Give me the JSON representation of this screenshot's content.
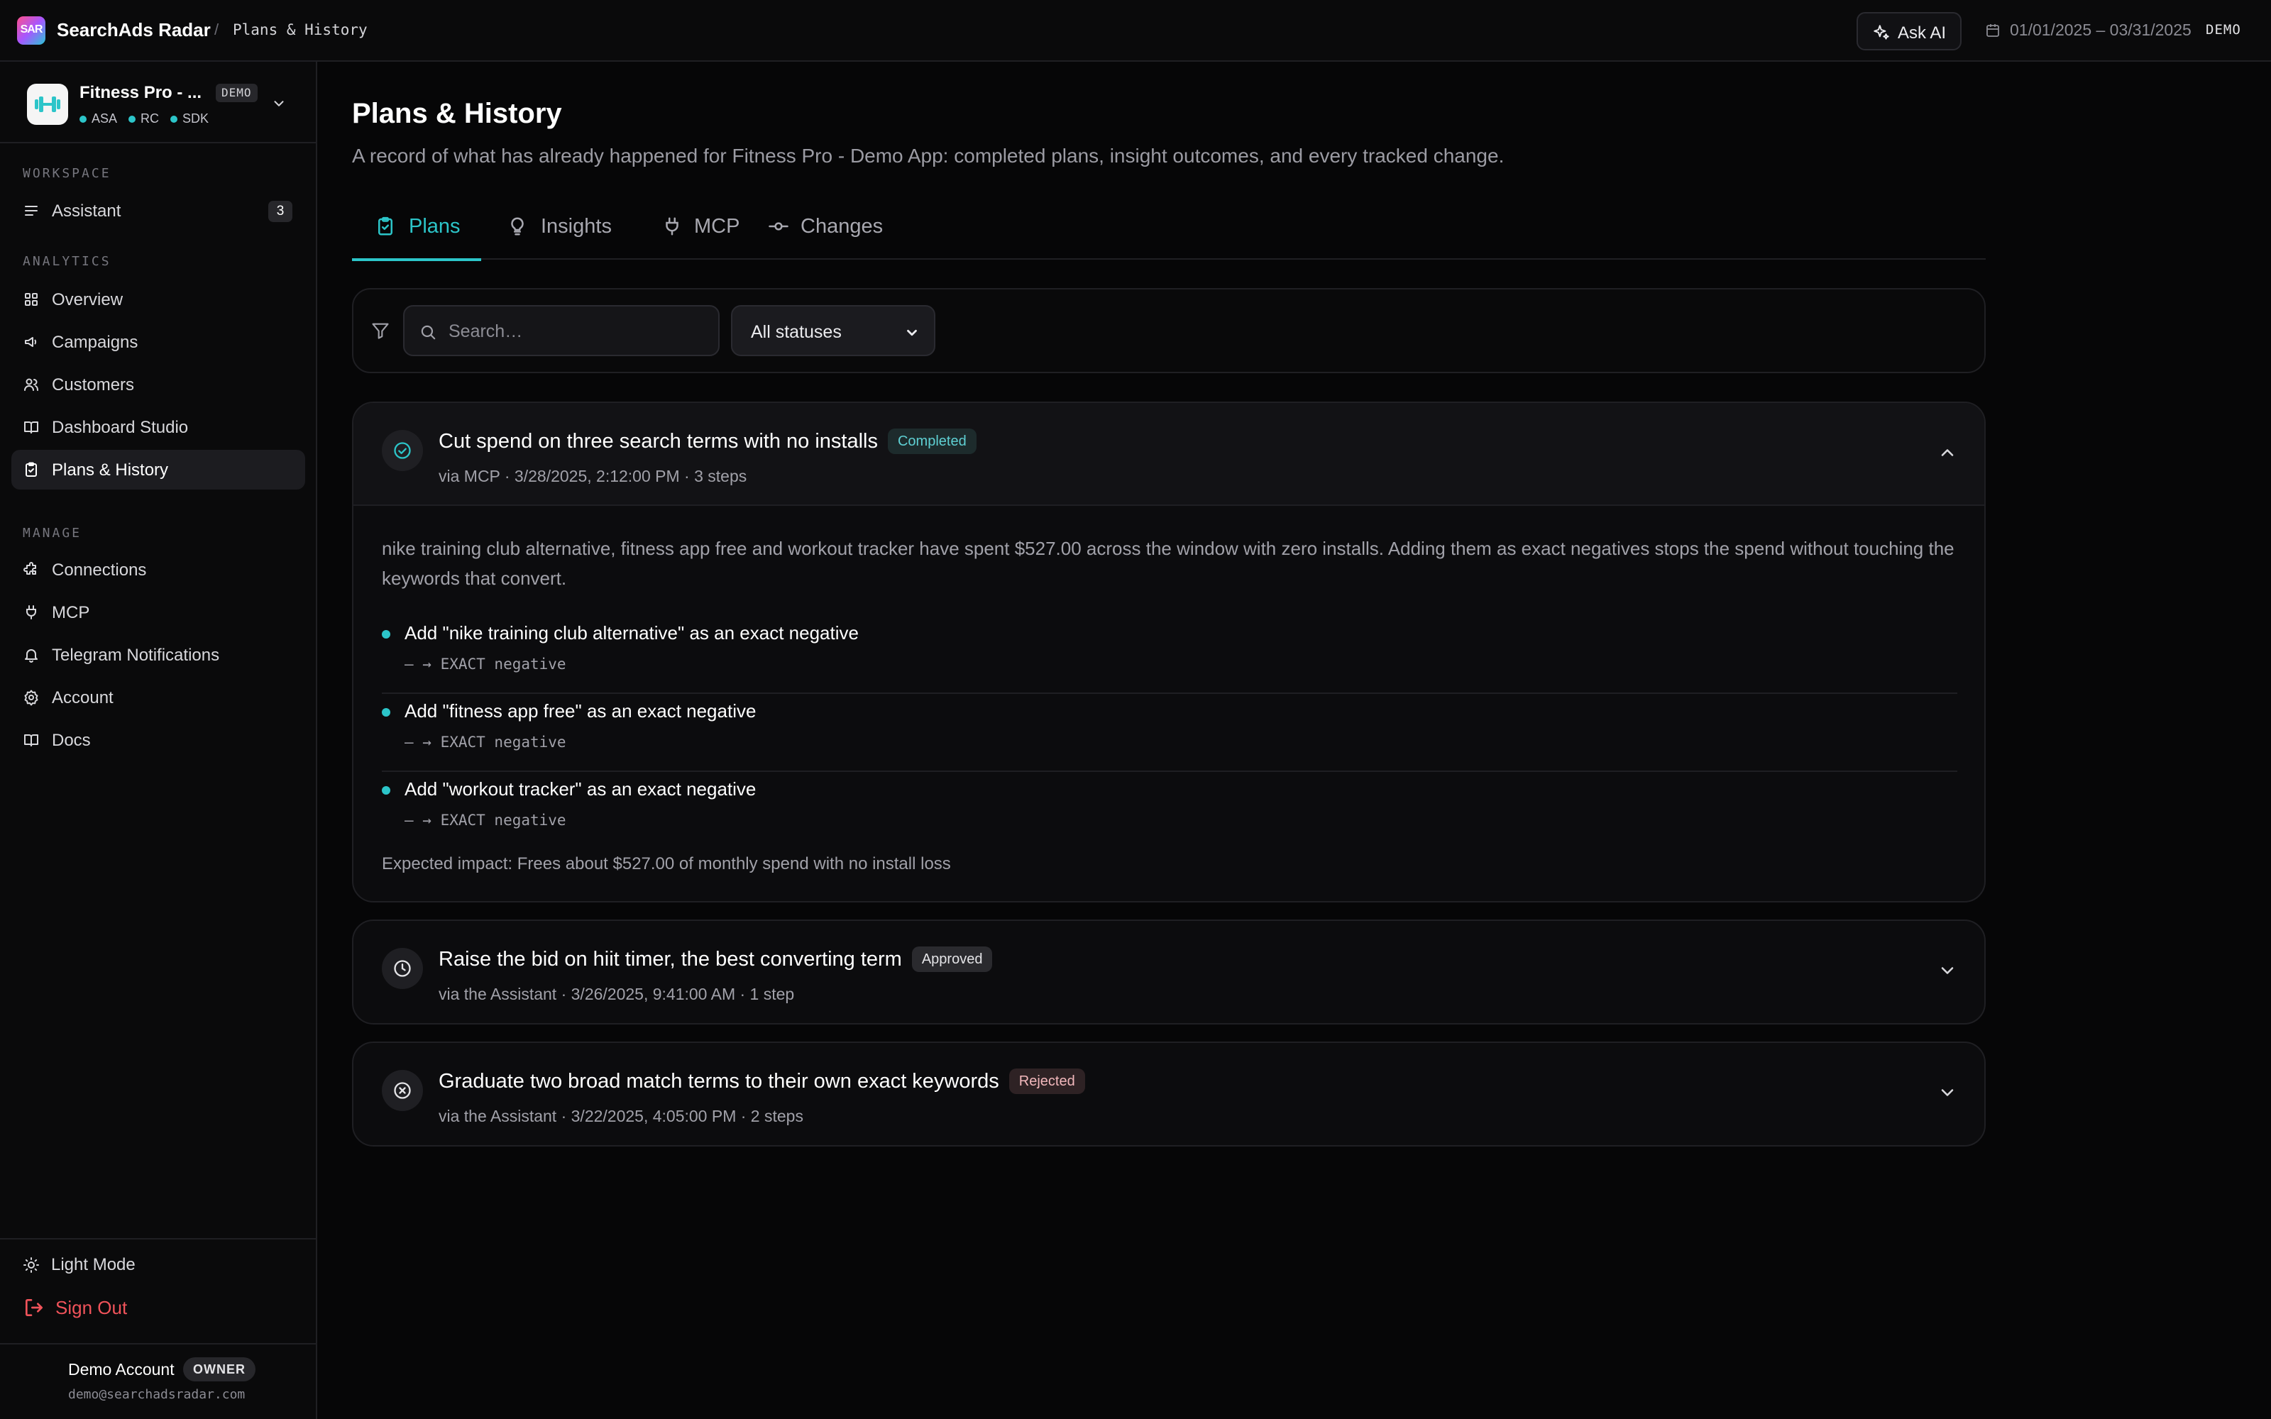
{
  "topbar": {
    "logo_text": "SAR",
    "brand": "SearchAds Radar",
    "separator": "/",
    "breadcrumb": "Plans & History",
    "ask_ai": "Ask AI",
    "date_range": "01/01/2025 – 03/31/2025",
    "demo": "DEMO"
  },
  "app": {
    "name": "Fitness Pro - ...",
    "badge": "DEMO",
    "sources": [
      "ASA",
      "RC",
      "SDK"
    ]
  },
  "sidebar": {
    "sections": [
      {
        "title": "WORKSPACE",
        "items": [
          {
            "label": "Assistant",
            "icon": "list-icon",
            "count": "3"
          }
        ]
      },
      {
        "title": "ANALYTICS",
        "items": [
          {
            "label": "Overview",
            "icon": "grid-icon"
          },
          {
            "label": "Campaigns",
            "icon": "megaphone-icon"
          },
          {
            "label": "Customers",
            "icon": "users-icon"
          },
          {
            "label": "Dashboard Studio",
            "icon": "book-open-icon"
          },
          {
            "label": "Plans & History",
            "icon": "clipboard-check-icon",
            "active": true
          }
        ]
      },
      {
        "title": "MANAGE",
        "items": [
          {
            "label": "Connections",
            "icon": "puzzle-icon"
          },
          {
            "label": "MCP",
            "icon": "plug-icon"
          },
          {
            "label": "Telegram Notifications",
            "icon": "bell-icon"
          },
          {
            "label": "Account",
            "icon": "gear-icon"
          },
          {
            "label": "Docs",
            "icon": "book-icon"
          }
        ]
      }
    ],
    "theme_toggle": "Light Mode",
    "sign_out": "Sign Out",
    "account": {
      "name": "Demo Account",
      "role": "OWNER",
      "email": "demo@searchadsradar.com"
    }
  },
  "page": {
    "title": "Plans & History",
    "subtitle": "A record of what has already happened for Fitness Pro - Demo App: completed plans, insight outcomes, and every tracked change."
  },
  "tabs": [
    {
      "label": "Plans",
      "icon": "clipboard-check-icon",
      "active": true
    },
    {
      "label": "Insights",
      "icon": "lightbulb-icon"
    },
    {
      "label": "MCP",
      "icon": "plug-icon"
    },
    {
      "label": "Changes",
      "icon": "commit-icon"
    }
  ],
  "filters": {
    "search_value": "",
    "search_placeholder": "Search…",
    "status_selected": "All statuses"
  },
  "plans": [
    {
      "title": "Cut spend on three search terms with no installs",
      "status": "Completed",
      "meta": "via MCP · 3/28/2025, 2:12:00 PM · 3 steps",
      "expanded": true,
      "icon": "check-circle-icon",
      "description": "nike training club alternative, fitness app free and workout tracker have spent $527.00 across the window with zero installs. Adding them as exact negatives stops the spend without touching the keywords that convert.",
      "steps": [
        {
          "title": "Add \"nike training club alternative\" as an exact negative",
          "detail": "– → EXACT negative"
        },
        {
          "title": "Add \"fitness app free\" as an exact negative",
          "detail": "– → EXACT negative"
        },
        {
          "title": "Add \"workout tracker\" as an exact negative",
          "detail": "– → EXACT negative"
        }
      ],
      "impact": "Expected impact: Frees about $527.00 of monthly spend with no install loss"
    },
    {
      "title": "Raise the bid on hiit timer, the best converting term",
      "status": "Approved",
      "meta": "via the Assistant · 3/26/2025, 9:41:00 AM · 1 step",
      "expanded": false,
      "icon": "clock-icon"
    },
    {
      "title": "Graduate two broad match terms to their own exact keywords",
      "status": "Rejected",
      "meta": "via the Assistant · 3/22/2025, 4:05:00 PM · 2 steps",
      "expanded": false,
      "icon": "x-circle-icon"
    }
  ],
  "colors": {
    "accent": "#2cc5c9",
    "danger": "#f0535a",
    "background": "#060607"
  }
}
